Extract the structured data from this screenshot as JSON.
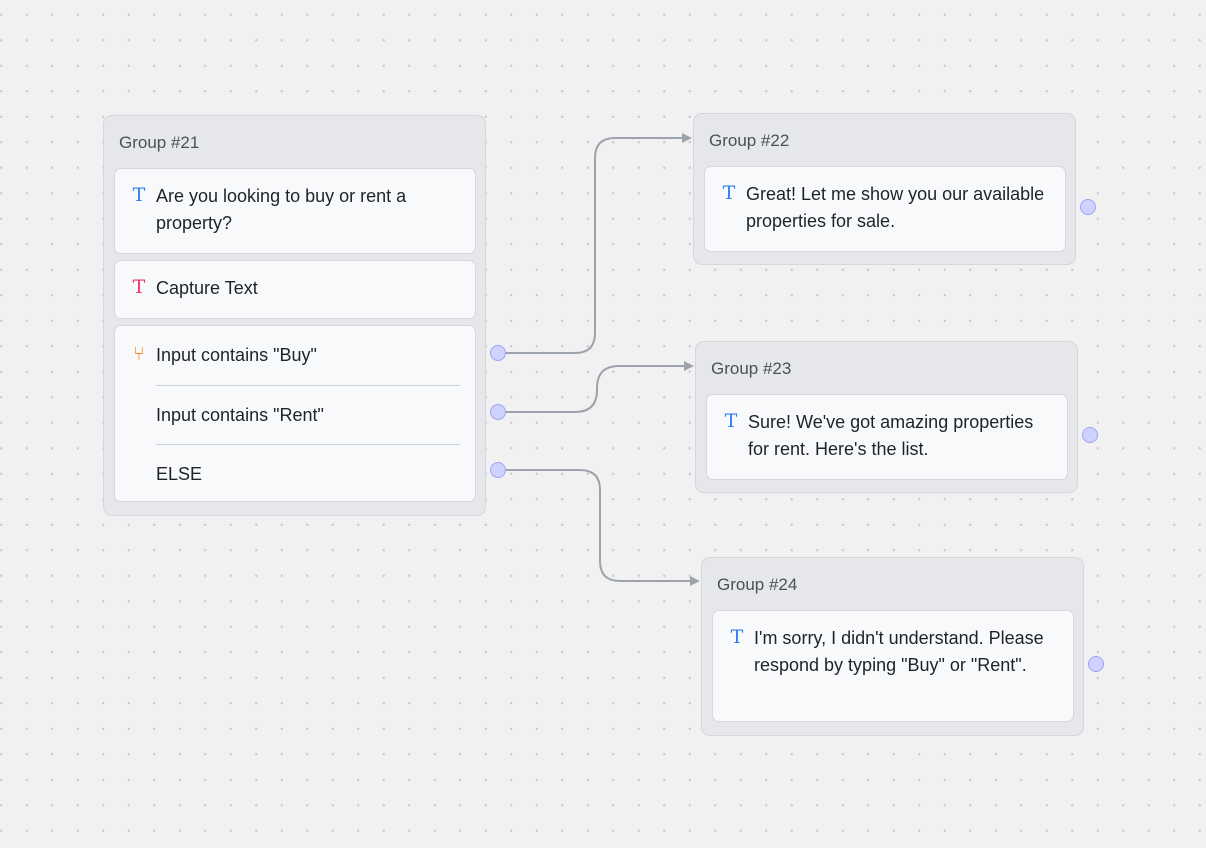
{
  "groups": [
    {
      "title": "Group #21",
      "blocks": [
        {
          "icon": "text-icon",
          "text": "Are you looking to buy or rent a property?"
        },
        {
          "icon": "capture-text-icon",
          "text": "Capture Text"
        }
      ],
      "conditions": {
        "icon": "branch-icon",
        "items": [
          "Input contains \"Buy\"",
          "Input contains \"Rent\"",
          "ELSE"
        ]
      }
    },
    {
      "title": "Group #22",
      "blocks": [
        {
          "icon": "text-icon",
          "text": "Great! Let me show you our available properties for sale."
        }
      ]
    },
    {
      "title": "Group #23",
      "blocks": [
        {
          "icon": "text-icon",
          "text": "Sure! We've got amazing properties for rent. Here's the list."
        }
      ]
    },
    {
      "title": "Group #24",
      "blocks": [
        {
          "icon": "text-icon",
          "text": "I'm sorry, I didn't understand. Please respond by typing \"Buy\" or \"Rent\"."
        }
      ]
    }
  ],
  "icons": {
    "text": "T",
    "capture": "T",
    "branch": "⑂"
  },
  "colors": {
    "canvas": "#f1f1f2",
    "text_icon": "#2f7ff0",
    "capture_icon": "#ec3a62",
    "branch_icon": "#f08a1a",
    "edge": "#9da3ad",
    "port": "#cfd2ff"
  }
}
